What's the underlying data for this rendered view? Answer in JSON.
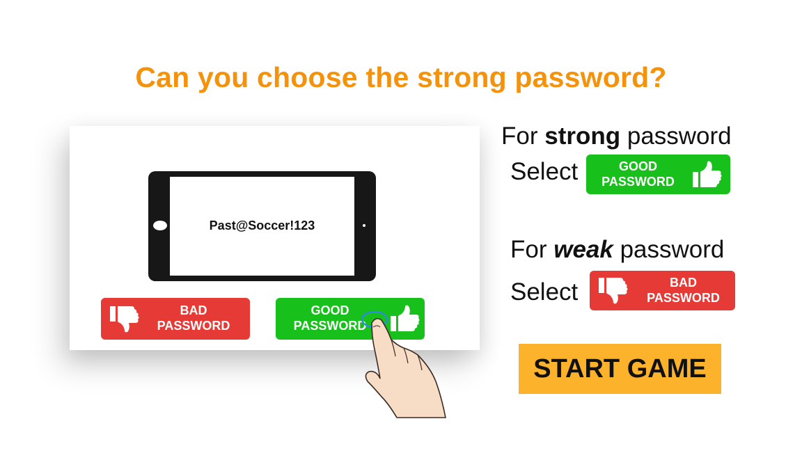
{
  "title": "Can you choose the strong password?",
  "demo": {
    "password_text": "Past@Soccer!123",
    "bad_button": {
      "line1": "BAD",
      "line2": "PASSWORD"
    },
    "good_button": {
      "line1": "GOOD",
      "line2": "PASSWORD"
    }
  },
  "rules": {
    "strong": {
      "prefix": "For ",
      "keyword": "strong",
      "suffix": " password",
      "select": "Select",
      "button_line1": "GOOD",
      "button_line2": "PASSWORD"
    },
    "weak": {
      "prefix": "For ",
      "keyword": "weak",
      "suffix": " password",
      "select": "Select",
      "button_line1": "BAD",
      "button_line2": "PASSWORD"
    }
  },
  "start_button": "START GAME",
  "colors": {
    "title": "#f5920c",
    "good": "#18c01b",
    "bad": "#e53a35",
    "start": "#fdb22c"
  },
  "icons": [
    "thumbs-up-icon",
    "thumbs-down-icon",
    "pointing-hand-icon",
    "smartphone-icon"
  ]
}
